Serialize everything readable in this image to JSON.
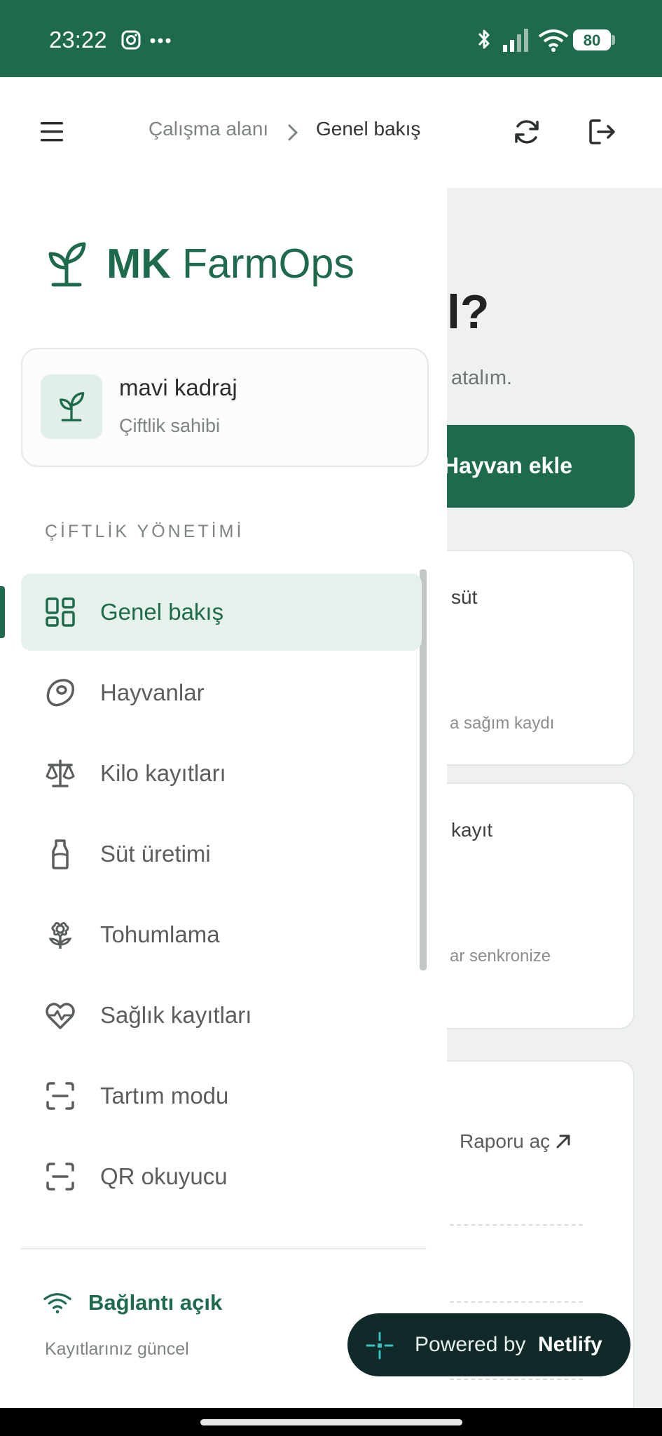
{
  "status_bar": {
    "time": "23:22",
    "battery": "80"
  },
  "header": {
    "breadcrumb": [
      "Çalışma alanı",
      "Genel bakış"
    ]
  },
  "drawer": {
    "brand_short": "MK",
    "brand_name": "FarmOps",
    "user_name": "mavi kadraj",
    "user_role": "Çiftlik sahibi",
    "section_title": "ÇİFTLİK YÖNETİMİ",
    "items": [
      {
        "label": "Genel bakış",
        "icon": "dashboard-icon",
        "active": true
      },
      {
        "label": "Hayvanlar",
        "icon": "meat-icon"
      },
      {
        "label": "Kilo kayıtları",
        "icon": "scale-icon"
      },
      {
        "label": "Süt üretimi",
        "icon": "milk-bottle-icon"
      },
      {
        "label": "Tohumlama",
        "icon": "flower-icon"
      },
      {
        "label": "Sağlık kayıtları",
        "icon": "heart-pulse-icon"
      },
      {
        "label": "Tartım modu",
        "icon": "scan-line-icon"
      },
      {
        "label": "QR okuyucu",
        "icon": "scan-line-icon"
      }
    ],
    "connection_label": "Bağlantı açık",
    "connection_sub": "Kayıtlarınız güncel"
  },
  "background": {
    "heading_fragment": "l?",
    "subtitle_fragment": "atalım.",
    "add_button": "Hayvan ekle",
    "card1_title": "süt",
    "card1_sub": "a sağım kaydı",
    "card2_title": "kayıt",
    "card2_sub": "ar senkronize",
    "report_link": "Raporu aç"
  },
  "netlify_badge": {
    "powered": "Powered by",
    "brand": "Netlify"
  },
  "colors": {
    "brand_green": "#1d6b4c",
    "active_bg": "#e6f1ec",
    "badge_bg": "#102a2a"
  }
}
